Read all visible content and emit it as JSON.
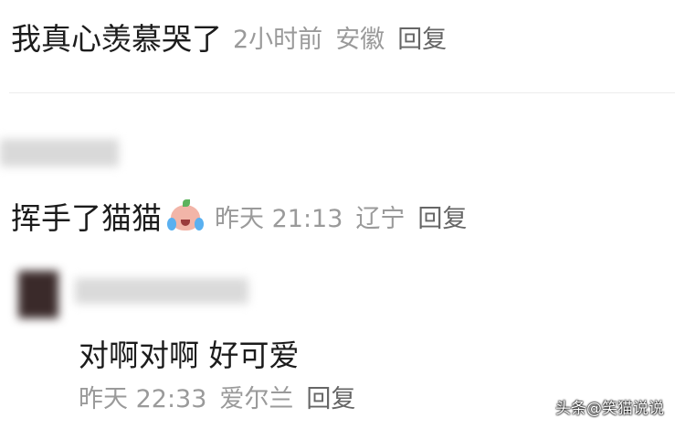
{
  "comments": [
    {
      "text": "我真心羡慕哭了",
      "time": "2小时前",
      "location": "安徽",
      "reply": "回复"
    },
    {
      "text": "挥手了猫猫",
      "emoji": "crying-laugh-emoji",
      "time": "昨天 21:13",
      "location": "辽宁",
      "reply": "回复"
    },
    {
      "text": "对啊对啊 好可爱",
      "time": "昨天 22:33",
      "location": "爱尔兰",
      "reply": "回复"
    }
  ],
  "watermark": "头条@笑猫说说"
}
